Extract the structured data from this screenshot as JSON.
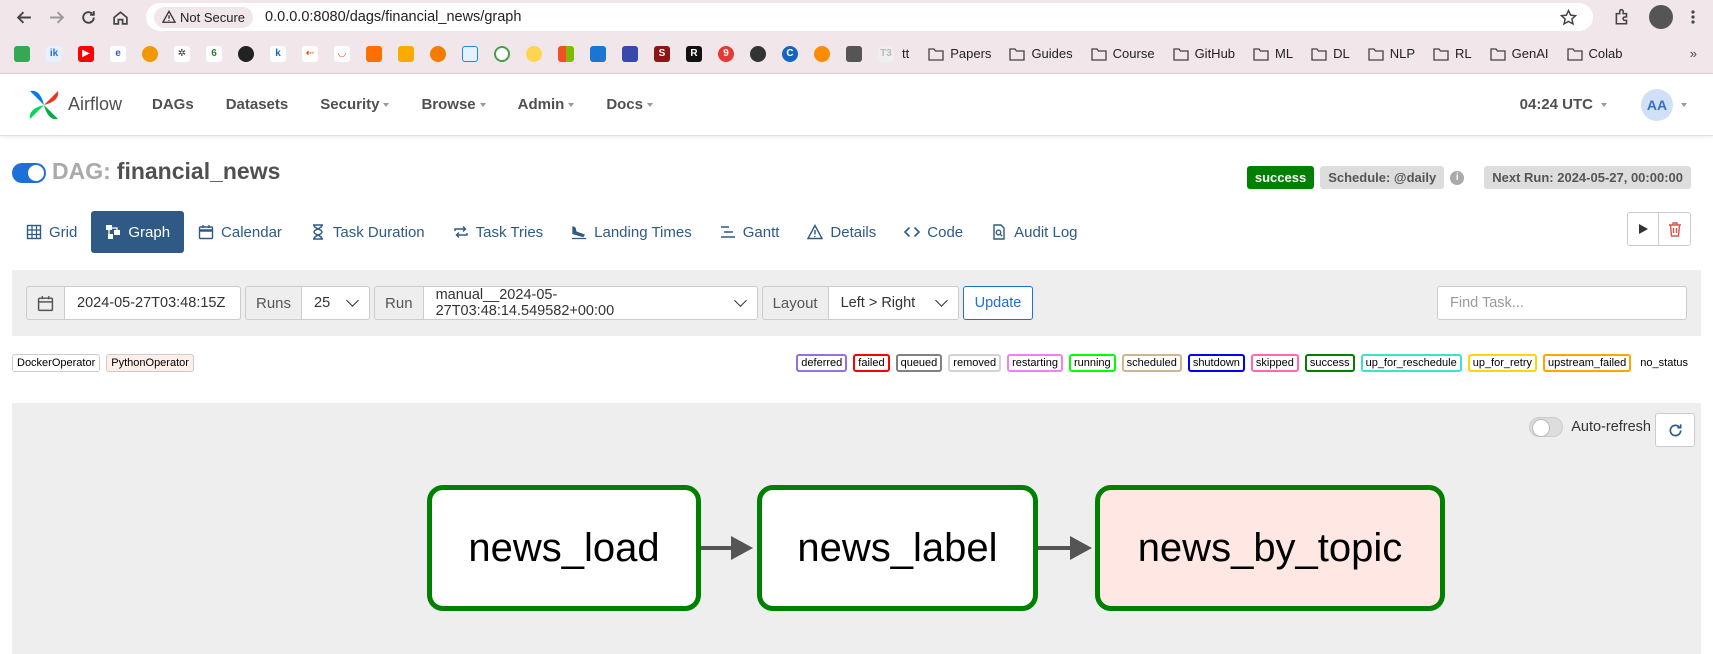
{
  "browser": {
    "security_label": "Not Secure",
    "url": "0.0.0.0:8080/dags/financial_news/graph",
    "bookmarks": {
      "tt": "tt",
      "folders": [
        "Papers",
        "Guides",
        "Course",
        "GitHub",
        "ML",
        "DL",
        "NLP",
        "RL",
        "GenAI",
        "Colab"
      ],
      "more": "»"
    }
  },
  "nav": {
    "brand": "Airflow",
    "items": [
      "DAGs",
      "Datasets",
      "Security",
      "Browse",
      "Admin",
      "Docs"
    ],
    "time": "04:24 UTC",
    "user_initials": "AA"
  },
  "dag": {
    "label": "DAG:",
    "name": "financial_news",
    "status": "success",
    "schedule": "Schedule: @daily",
    "next_run": "Next Run: 2024-05-27, 00:00:00"
  },
  "tabs": [
    "Grid",
    "Graph",
    "Calendar",
    "Task Duration",
    "Task Tries",
    "Landing Times",
    "Gantt",
    "Details",
    "Code",
    "Audit Log"
  ],
  "filters": {
    "date": "2024-05-27T03:48:15Z",
    "runs_label": "Runs",
    "runs_value": "25",
    "run_label": "Run",
    "run_value": "manual__2024-05-27T03:48:14.549582+00:00",
    "layout_label": "Layout",
    "layout_value": "Left > Right",
    "update": "Update",
    "find_placeholder": "Find Task..."
  },
  "operators": [
    "DockerOperator",
    "PythonOperator"
  ],
  "states": [
    {
      "label": "deferred",
      "color": "#9370db"
    },
    {
      "label": "failed",
      "color": "#ff0000"
    },
    {
      "label": "queued",
      "color": "#808080"
    },
    {
      "label": "removed",
      "color": "#d3d3d3"
    },
    {
      "label": "restarting",
      "color": "#ee82ee"
    },
    {
      "label": "running",
      "color": "#00ff00"
    },
    {
      "label": "scheduled",
      "color": "#d2b48c"
    },
    {
      "label": "shutdown",
      "color": "#0000ff"
    },
    {
      "label": "skipped",
      "color": "#ff69b4"
    },
    {
      "label": "success",
      "color": "#008000"
    },
    {
      "label": "up_for_reschedule",
      "color": "#40e0d0"
    },
    {
      "label": "up_for_retry",
      "color": "#ffd700"
    },
    {
      "label": "upstream_failed",
      "color": "#ffa500"
    },
    {
      "label": "no_status",
      "color": ""
    }
  ],
  "graph": {
    "autorefresh": "Auto-refresh",
    "nodes": [
      "news_load",
      "news_label",
      "news_by_topic"
    ]
  }
}
